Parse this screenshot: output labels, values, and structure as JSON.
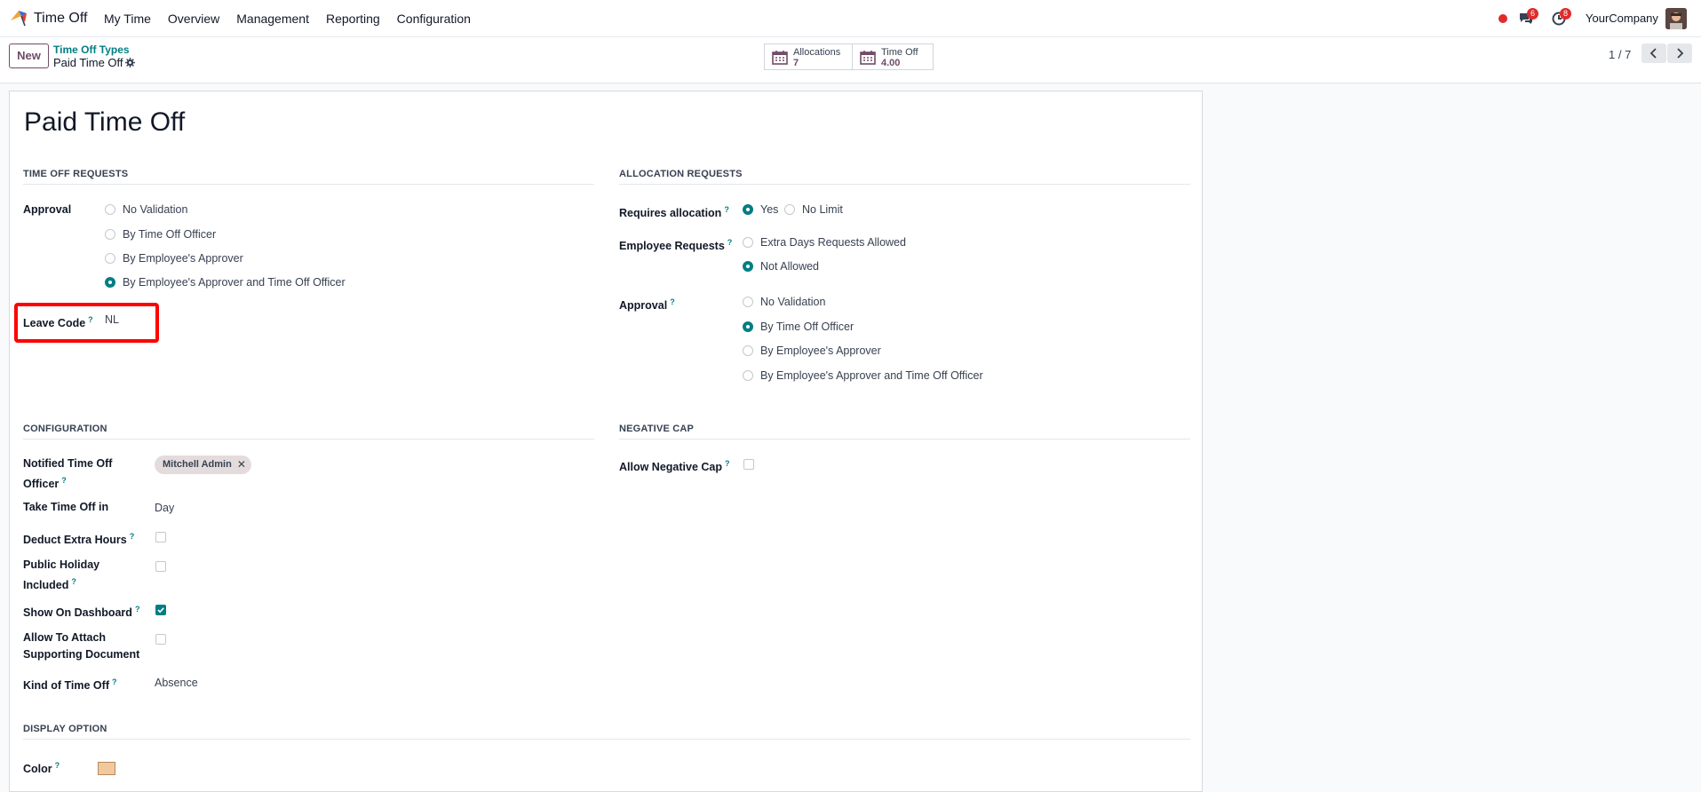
{
  "navbar": {
    "app_name": "Time Off",
    "menu": [
      "My Time",
      "Overview",
      "Management",
      "Reporting",
      "Configuration"
    ],
    "messages_count": "6",
    "activities_count": "8",
    "company": "YourCompany"
  },
  "control": {
    "new_label": "New",
    "breadcrumb_parent": "Time Off Types",
    "breadcrumb_current": "Paid Time Off",
    "smart_buttons": [
      {
        "label": "Allocations",
        "value": "7"
      },
      {
        "label": "Time Off",
        "value": "4.00"
      }
    ],
    "pager": "1 / 7"
  },
  "form": {
    "title": "Paid Time Off",
    "time_off_requests": {
      "title": "TIME OFF REQUESTS",
      "approval_label": "Approval",
      "approval_options": [
        "No Validation",
        "By Time Off Officer",
        "By Employee's Approver",
        "By Employee's Approver and Time Off Officer"
      ],
      "approval_selected": "By Employee's Approver and Time Off Officer",
      "leave_code_label": "Leave Code",
      "leave_code_value": "NL"
    },
    "allocation_requests": {
      "title": "ALLOCATION REQUESTS",
      "requires_allocation_label": "Requires allocation",
      "requires_allocation_options": [
        "Yes",
        "No Limit"
      ],
      "requires_allocation_selected": "Yes",
      "employee_requests_label": "Employee Requests",
      "employee_requests_options": [
        "Extra Days Requests Allowed",
        "Not Allowed"
      ],
      "employee_requests_selected": "Not Allowed",
      "approval_label": "Approval",
      "approval_options": [
        "No Validation",
        "By Time Off Officer",
        "By Employee's Approver",
        "By Employee's Approver and Time Off Officer"
      ],
      "approval_selected": "By Time Off Officer"
    },
    "configuration": {
      "title": "CONFIGURATION",
      "notified_officer_label_1": "Notified Time Off",
      "notified_officer_label_2": "Officer",
      "notified_officer_tag": "Mitchell Admin",
      "take_time_off_in_label": "Take Time Off in",
      "take_time_off_in_value": "Day",
      "deduct_extra_hours_label": "Deduct Extra Hours",
      "deduct_extra_hours": false,
      "public_holiday_label_1": "Public Holiday",
      "public_holiday_label_2": "Included",
      "public_holiday_included": false,
      "show_on_dashboard_label": "Show On Dashboard",
      "show_on_dashboard": true,
      "allow_attach_label_1": "Allow To Attach",
      "allow_attach_label_2": "Supporting Document",
      "allow_attach": false,
      "kind_label": "Kind of Time Off",
      "kind_value": "Absence"
    },
    "negative_cap": {
      "title": "NEGATIVE CAP",
      "allow_negative_cap_label": "Allow Negative Cap",
      "allow_negative_cap": false
    },
    "display_option": {
      "title": "DISPLAY OPTION",
      "color_label": "Color",
      "color_value": "#f2c89d"
    },
    "help_mark": "?"
  },
  "colors": {
    "brand": "#714b67",
    "accent": "#017e84",
    "highlight": "#ff0000"
  }
}
